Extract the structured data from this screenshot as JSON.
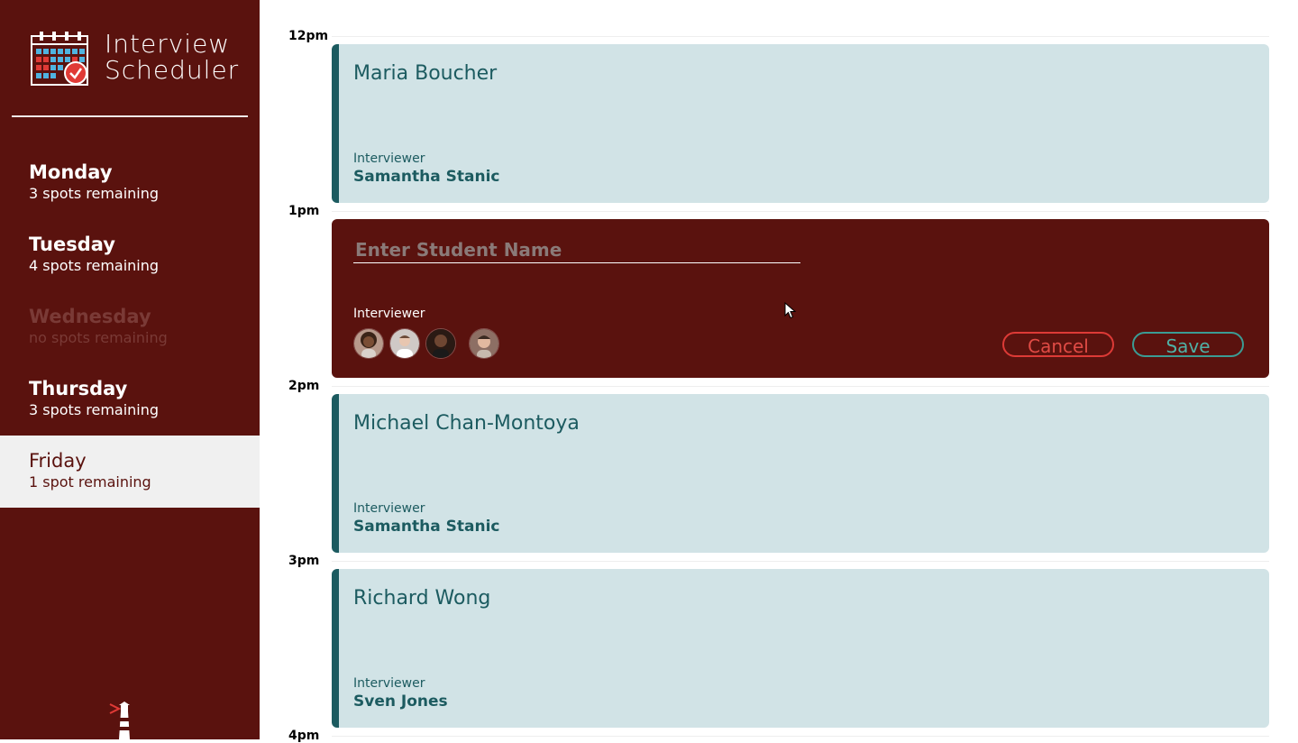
{
  "app": {
    "title_line1": "Interview",
    "title_line2": "Scheduler"
  },
  "colors": {
    "sidebar_bg": "#5a120e",
    "card_bg": "#d1e3e6",
    "accent_teal": "#1c5b60",
    "cancel_red": "#dd3a36",
    "save_teal": "#3b9c94"
  },
  "sidebar": {
    "days": [
      {
        "name": "Monday",
        "spots": "3 spots remaining",
        "state": "normal"
      },
      {
        "name": "Tuesday",
        "spots": "4 spots remaining",
        "state": "normal"
      },
      {
        "name": "Wednesday",
        "spots": "no spots remaining",
        "state": "full"
      },
      {
        "name": "Thursday",
        "spots": "3 spots remaining",
        "state": "normal"
      },
      {
        "name": "Friday",
        "spots": "1 spot remaining",
        "state": "selected"
      }
    ]
  },
  "schedule": {
    "times": [
      "12pm",
      "1pm",
      "2pm",
      "3pm",
      "4pm"
    ],
    "appointments": [
      {
        "student": "Maria Boucher",
        "interviewer_label": "Interviewer",
        "interviewer": "Samantha Stanic"
      },
      {
        "form": true
      },
      {
        "student": "Michael Chan-Montoya",
        "interviewer_label": "Interviewer",
        "interviewer": "Samantha Stanic"
      },
      {
        "student": "Richard Wong",
        "interviewer_label": "Interviewer",
        "interviewer": "Sven Jones"
      }
    ]
  },
  "form": {
    "placeholder": "Enter Student Name",
    "value": "",
    "interviewer_label": "Interviewer",
    "avatar_icons": [
      "interviewer-avatar-1",
      "interviewer-avatar-2",
      "interviewer-avatar-3",
      "interviewer-avatar-4"
    ],
    "cancel_label": "Cancel",
    "save_label": "Save"
  }
}
